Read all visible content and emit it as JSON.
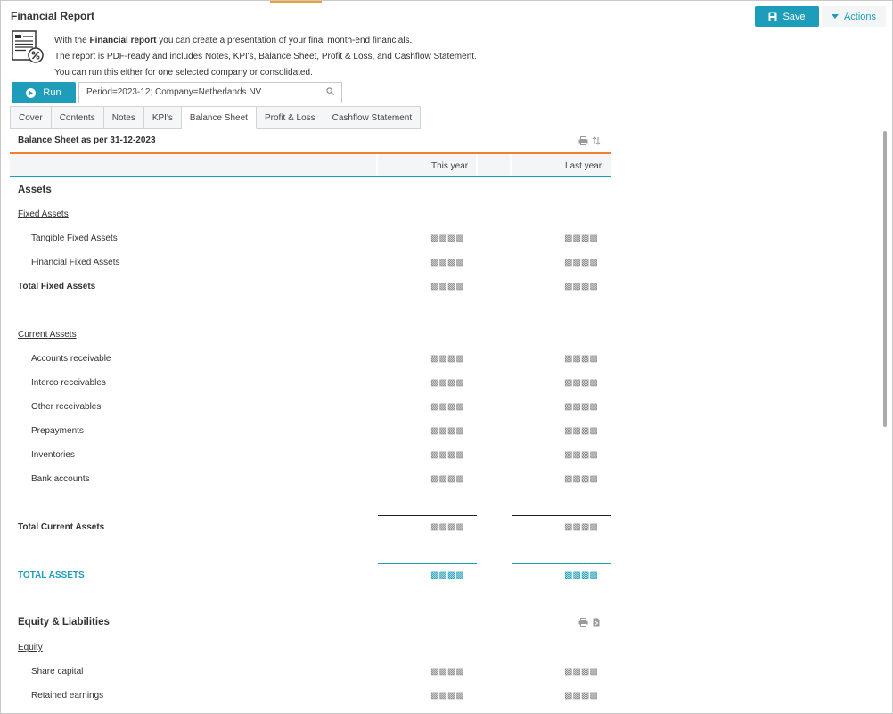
{
  "header": {
    "title": "Financial Report",
    "save_label": "Save",
    "actions_label": "Actions"
  },
  "intro": {
    "line1_prefix": "With the ",
    "line1_bold": "Financial report",
    "line1_suffix": " you can create a presentation of your final month-end financials.",
    "line2": "The report is PDF-ready and includes Notes, KPI's, Balance Sheet, Profit & Loss, and Cashflow Statement.",
    "line3": "You can run this either for one selected company or consolidated."
  },
  "run": {
    "label": "Run",
    "parameters": "Period=2023-12; Company=Netherlands NV"
  },
  "tabs": [
    {
      "label": "Cover",
      "active": false
    },
    {
      "label": "Contents",
      "active": false
    },
    {
      "label": "Notes",
      "active": false
    },
    {
      "label": "KPI's",
      "active": false
    },
    {
      "label": "Balance Sheet",
      "active": true
    },
    {
      "label": "Profit & Loss",
      "active": false
    },
    {
      "label": "Cashflow Statement",
      "active": false
    }
  ],
  "sheet": {
    "title": "Balance Sheet as per 31-12-2023",
    "col_this_year": "This year",
    "col_last_year": "Last year",
    "masked_value": "▩▩▩▩",
    "assets_title": "Assets",
    "fixed_assets_title": "Fixed Assets",
    "fixed_assets": [
      "Tangible Fixed Assets",
      "Financial Fixed Assets"
    ],
    "total_fixed_assets": "Total Fixed Assets",
    "current_assets_title": "Current Assets",
    "current_assets": [
      "Accounts receivable",
      "Interco receivables",
      "Other receivables",
      "Prepayments",
      "Inventories",
      "Bank accounts"
    ],
    "total_current_assets": "Total Current Assets",
    "total_assets": "TOTAL ASSETS",
    "equity_liabilities_title": "Equity & Liabilities",
    "equity_title": "Equity",
    "equity": [
      "Share capital",
      "Retained earnings"
    ]
  },
  "icons": {
    "report": "report-percent-icon",
    "save": "floppy-disk-icon",
    "actions": "caret-down-icon",
    "run": "play-circle-icon",
    "search": "search-icon",
    "print": "print-icon",
    "sort": "sort-arrows-icon",
    "export": "export-file-icon"
  },
  "colors": {
    "accent": "#1e9dba",
    "tab_underline": "#f08030"
  }
}
